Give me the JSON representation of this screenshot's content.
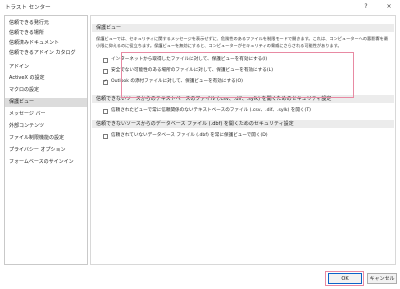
{
  "window": {
    "title": "トラスト センター",
    "help_label": "?",
    "close_label": "×"
  },
  "sidebar": {
    "items": [
      {
        "label": "信頼できる発行元",
        "selected": false
      },
      {
        "label": "信頼できる場所",
        "selected": false
      },
      {
        "label": "信頼済みドキュメント",
        "selected": false
      },
      {
        "label": "信頼できるアドイン カタログ",
        "selected": false
      },
      {
        "label": "アドイン",
        "selected": false
      },
      {
        "label": "ActiveX の設定",
        "selected": false
      },
      {
        "label": "マクロの設定",
        "selected": false
      },
      {
        "label": "保護ビュー",
        "selected": true
      },
      {
        "label": "メッセージ バー",
        "selected": false
      },
      {
        "label": "外部コンテンツ",
        "selected": false
      },
      {
        "label": "ファイル制限機能の設定",
        "selected": false
      },
      {
        "label": "プライバシー オプション",
        "selected": false
      },
      {
        "label": "フォームベースのサインイン",
        "selected": false
      }
    ]
  },
  "protected_view": {
    "header": "保護ビュー",
    "description": "保護ビューでは、セキュリティに関するメッセージを表示せずに、危険性のあるファイルを制限モードで開きます。これは、コンピューターへの悪影響を最小限に抑えるのに役立ちます。保護ビューを無効にすると、コンピューターがセキュリティの脅威にさらされる可能性があります。",
    "options": [
      {
        "label": "インターネットから取得したファイルに対して、保護ビューを有効にする(I)",
        "checked": false
      },
      {
        "label": "安全でない可能性のある場所のファイルに対して、保護ビューを有効にする(L)",
        "checked": false
      },
      {
        "label": "Outlook の添付ファイルに対して、保護ビューを有効にする(O)",
        "checked": true
      }
    ]
  },
  "text_source_section": {
    "header": "信頼できないソースからのテキストベースのファイル (.csv、.dif、.sylk) を開くためのセキュリティ設定",
    "option": {
      "label": "信頼されたビューで常に信頼関係のないテキストベースのファイル (.csv、.dif、.sylk) を開く(T)",
      "checked": false
    }
  },
  "database_section": {
    "header": "信頼できないソースからのデータベース ファイル (.dbf) を開くためのセキュリティ設定",
    "option": {
      "label": "信頼されていないデータベース ファイル (.dbf) を常に保護ビューで開く(D)",
      "checked": false
    }
  },
  "buttons": {
    "ok": "OK",
    "cancel": "キャンセル"
  },
  "colors": {
    "highlight": "#e88aa3",
    "selected_item": "#dcdcdc",
    "ok_border": "#0a64c8"
  }
}
